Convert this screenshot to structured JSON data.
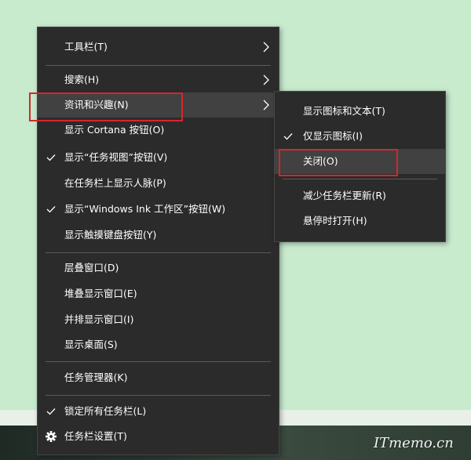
{
  "main_menu": {
    "items": [
      {
        "label": "工具栏(T)",
        "submenu": true
      },
      {
        "label": "搜索(H)",
        "submenu": true
      },
      {
        "label": "资讯和兴趣(N)",
        "submenu": true,
        "highlighted": true
      },
      {
        "label": "显示 Cortana 按钮(O)"
      },
      {
        "label": "显示“任务视图”按钮(V)",
        "checked": true
      },
      {
        "label": "在任务栏上显示人脉(P)"
      },
      {
        "label": "显示“Windows Ink 工作区”按钮(W)",
        "checked": true
      },
      {
        "label": "显示触摸键盘按钮(Y)"
      },
      {
        "label": "层叠窗口(D)"
      },
      {
        "label": "堆叠显示窗口(E)"
      },
      {
        "label": "并排显示窗口(I)"
      },
      {
        "label": "显示桌面(S)"
      },
      {
        "label": "任务管理器(K)"
      },
      {
        "label": "锁定所有任务栏(L)",
        "checked": true
      },
      {
        "label": "任务栏设置(T)",
        "icon": "gear-icon"
      }
    ]
  },
  "sub_menu": {
    "items": [
      {
        "label": "显示图标和文本(T)"
      },
      {
        "label": "仅显示图标(I)",
        "checked": true
      },
      {
        "label": "关闭(O)",
        "highlighted": true
      },
      {
        "label": "减少任务栏更新(R)"
      },
      {
        "label": "悬停时打开(H)"
      }
    ]
  },
  "colors": {
    "desktop": "#c8eacd",
    "menu_bg": "#2b2b2b",
    "menu_highlight": "#414141",
    "annotation_red": "#d9252b"
  },
  "watermark": "ITmemo.cn"
}
